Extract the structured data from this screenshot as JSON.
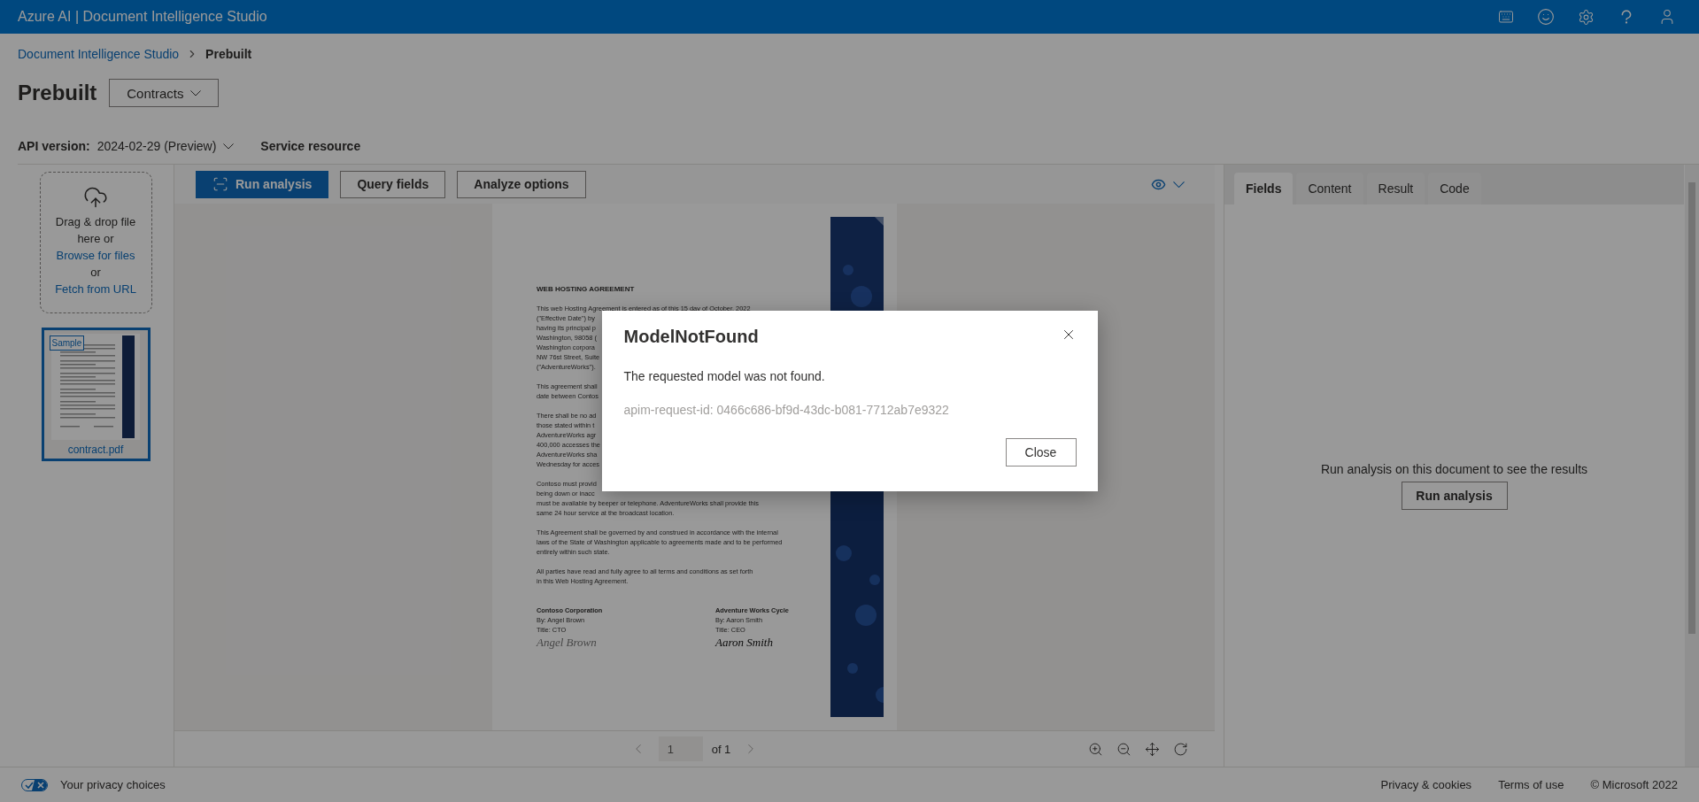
{
  "header": {
    "title": "Azure AI | Document Intelligence Studio"
  },
  "breadcrumb": [
    {
      "label": "Document Intelligence Studio",
      "kind": "link"
    },
    {
      "label": "Prebuilt",
      "kind": "current"
    }
  ],
  "page_title": "Prebuilt",
  "model_dropdown": {
    "value": "Contracts"
  },
  "api_version": {
    "label": "API version:",
    "value": "2024-02-29 (Preview)"
  },
  "service_resource": {
    "label": "Service resource"
  },
  "upload": {
    "text": "Drag & drop file here or",
    "browse_link": "Browse for files",
    "separator": "or",
    "fetch_link": "Fetch from URL"
  },
  "files": [
    {
      "name": "contract.pdf",
      "badge": "Sample",
      "selected": true
    }
  ],
  "toolbar": [
    {
      "label": "Run analysis",
      "kind": "primary"
    },
    {
      "label": "Query fields",
      "kind": "default"
    },
    {
      "label": "Analyze options",
      "kind": "default"
    }
  ],
  "document": {
    "heading": "WEB HOSTING AGREEMENT",
    "paragraphs": [
      [
        "This web Hosting Agreement is entered as of this 15 day of October, 2022",
        "(\"Effective Date\") by",
        "having its principal p",
        "Washington, 98058 (",
        "Washington corpora",
        "NW 76st Street, Suite",
        "(\"AdventureWorks\")."
      ],
      [
        "This agreement shall",
        "date between Contos"
      ],
      [
        "There shall be no ad",
        "those stated within t",
        "AdventureWorks agr",
        "400,000 accesses the",
        "AdventureWorks sha",
        "Wednesday for acces"
      ],
      [
        "Contoso must provid",
        "being down or inacc",
        "must be available by beeper or telephone. AdventureWorks shall provide this",
        "same 24 hour service at the broadcast location."
      ],
      [
        "This Agreement shall be governed by and construed in accordance with the internal",
        "laws of the State of Washington applicable to agreements made and to be performed",
        "entirely within such state."
      ],
      [
        "All parties have read and fully agree to all terms and conditions as set forth",
        "in this Web Hosting Agreement."
      ]
    ],
    "signatures": [
      {
        "company": "Contoso Corporation",
        "by": "By: Angel Brown",
        "title": "Title: CTO",
        "signature": "Angel Brown"
      },
      {
        "company": "Adventure Works Cycle",
        "by": "By: Aaron Smith",
        "title": "Title: CEO",
        "signature": "Aaron Smith"
      }
    ]
  },
  "pager": {
    "page": "1",
    "total": "of 1"
  },
  "result_tabs": [
    {
      "label": "Fields",
      "selected": true
    },
    {
      "label": "Content",
      "selected": false
    },
    {
      "label": "Result",
      "selected": false
    },
    {
      "label": "Code",
      "selected": false
    }
  ],
  "result_panel": {
    "message": "Run analysis on this document to see the results",
    "button": "Run analysis"
  },
  "footer": {
    "privacy": "Your privacy choices",
    "links": [
      "Privacy & cookies",
      "Terms of use"
    ],
    "copyright": "© Microsoft 2022"
  },
  "dialog": {
    "title": "ModelNotFound",
    "message": "The requested model was not found.",
    "request_id": "apim-request-id: 0466c686-bf9d-43dc-b081-7712ab7e9322",
    "button": "Close"
  }
}
